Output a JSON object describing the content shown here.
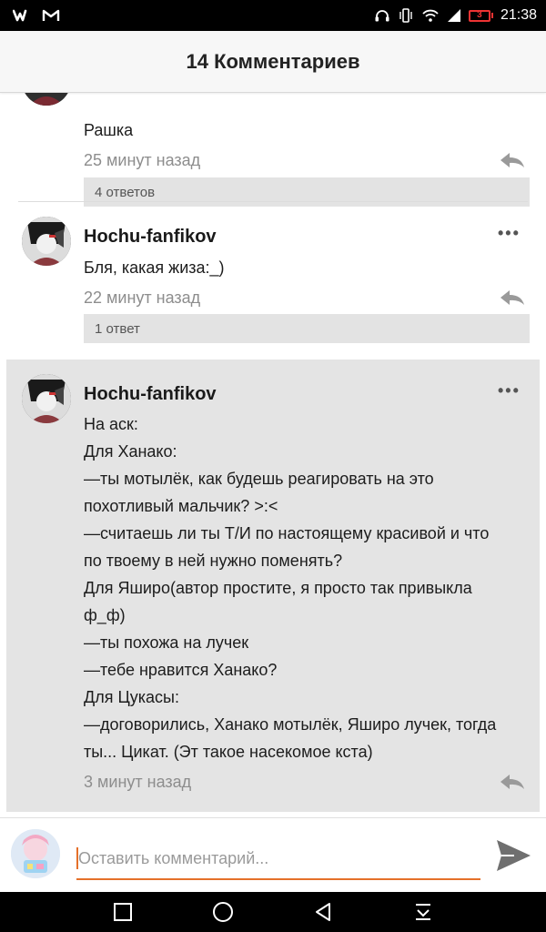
{
  "status_bar": {
    "time": "21:38",
    "battery_level": "3",
    "app_icons": [
      "wattpad-w-icon",
      "gmail-m-icon"
    ],
    "accent_battery": "#e33333"
  },
  "header": {
    "title": "14 Комментариев"
  },
  "comments": [
    {
      "username": "",
      "text": "Рашка",
      "time": "25 минут назад",
      "replies": "4 ответов"
    },
    {
      "username": "Hochu-fanfikov",
      "text": "Бля, какая жиза:_)",
      "time": "22 минут назад",
      "replies": "1 ответ"
    },
    {
      "username": "Hochu-fanfikov",
      "lines": [
        "На аск:",
        "Для Ханако:",
        "—ты мотылёк, как будешь реагировать на это",
        "похотливый мальчик? >:<",
        "—считаешь ли ты Т/И по настоящему красивой и что",
        "по твоему в ней нужно поменять?",
        "Для Яширо(автор простите, я просто так привыкла",
        "ф_ф)",
        "—ты похожа на лучек",
        "—тебе нравится Ханако?",
        "Для Цукасы:",
        "—договорились, Ханако мотылёк, Яширо лучек, тогда",
        "ты... Цикат. (Эт такое насекомое кста)"
      ],
      "time": "3 минут назад"
    }
  ],
  "input": {
    "placeholder": "Оставить комментарий...",
    "accent": "#e5702a"
  },
  "more_label": "•••"
}
